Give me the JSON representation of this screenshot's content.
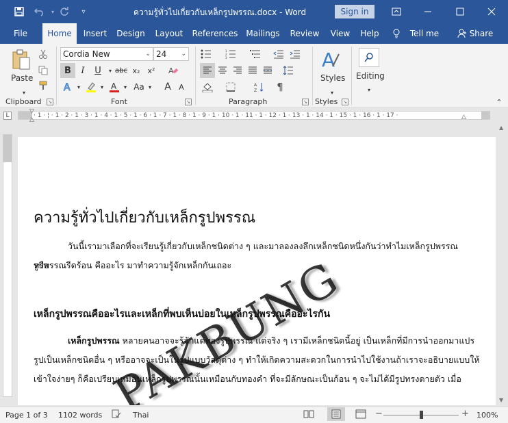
{
  "window": {
    "title": "ความรู้ทั่วไปเกี่ยวกับเหล็กรูปพรรณ.docx  -  Word",
    "signin_label": "Sign in",
    "qat_icons": [
      "save-icon",
      "undo-icon",
      "redo-icon",
      "customize-icon"
    ],
    "controls": [
      "ribbon-display-icon",
      "minimize-icon",
      "maximize-icon",
      "close-icon"
    ]
  },
  "tabs": [
    {
      "label": "File"
    },
    {
      "label": "Home"
    },
    {
      "label": "Insert"
    },
    {
      "label": "Design"
    },
    {
      "label": "Layout"
    },
    {
      "label": "References"
    },
    {
      "label": "Mailings"
    },
    {
      "label": "Review"
    },
    {
      "label": "View"
    },
    {
      "label": "Help"
    },
    {
      "label": "Tell me"
    },
    {
      "label": "Share"
    }
  ],
  "ribbon": {
    "clipboard": {
      "label": "Clipboard",
      "paste_label": "Paste"
    },
    "font": {
      "label": "Font",
      "font_name": "Cordia New",
      "font_size": "24",
      "bold": "B",
      "italic": "I",
      "underline": "U",
      "strike": "abc",
      "subscript": "x₂",
      "superscript": "x²",
      "change_case": "Aa",
      "grow": "A",
      "shrink": "A"
    },
    "paragraph": {
      "label": "Paragraph"
    },
    "styles": {
      "label": "Styles",
      "button_label": "Styles"
    },
    "editing": {
      "button_label": "Editing"
    }
  },
  "ruler": {
    "numbers": "· 1 · ¦ · 1 · 2 · 1 · 3 · 1 · 4 · 1 · 5 · 1 · 6 · 1 · 7 · 1 · 8 · 1 · 9 · 1 · 10 · 1 · 11 · 1 · 12 · 1 · 13 · 1 · 14 · 1 · 15 · 1 · 16 · 1 · 17 ·"
  },
  "document": {
    "heading": "ความรู้ทั่วไปเกี่ยวกับเหล็กรูปพรรณ",
    "intro_line1": "วันนี้เรามาเลือกที่จะเรียนรู้เกี่ยวกับเหล็กชนิดต่าง ๆ และมาลองลงลึกเหล็กชนิดหนึ่งกันว่าทำไมเหล็กรูปพรรณหรือ",
    "intro_line2": "รูปพรรณรีดร้อน คืออะไร มาทำความรู้จักเหล็กกันเถอะ",
    "subheading": "เหล็กรูปพรรณคืออะไรและเหล็กที่พบเห็นบ่อยในเหล็กรูปพรรณคืออะไรกัน",
    "body_line1_bold": "เหล็กรูปพรรณ",
    "body_line1": " หลายคนอาจจะรู้จักแต่ทองรูปพรรณ แต่จริง ๆ เรามีเหล็กชนิดนี้อยู่ เป็นเหล็กที่มีการนำออกมาแปร",
    "body_line2": "รูปเป็นเหล็กชนิดอื่น ๆ หรืออาจจะเป็นในรูปแบบวัสดุต่าง ๆ ทำให้เกิดความสะดวกในการนำไปใช้งานถ้าเราจะอธิบายแบบให้",
    "body_line3": "เข้าใจง่ายๆ ก็คือเปรียบเหมือนเหล็กรูปพรรณนั้นเหมือนกับทองคำ ที่จะมีลักษณะเป็นก้อน ๆ จะไม่ได้มีรูปทรงตายตัว เมื่อ",
    "watermark": "PAKBUNG"
  },
  "status": {
    "page": "Page 1 of 3",
    "words": "1102 words",
    "language": "Thai",
    "zoom": "100%",
    "zoom_fraction": 0.5
  }
}
